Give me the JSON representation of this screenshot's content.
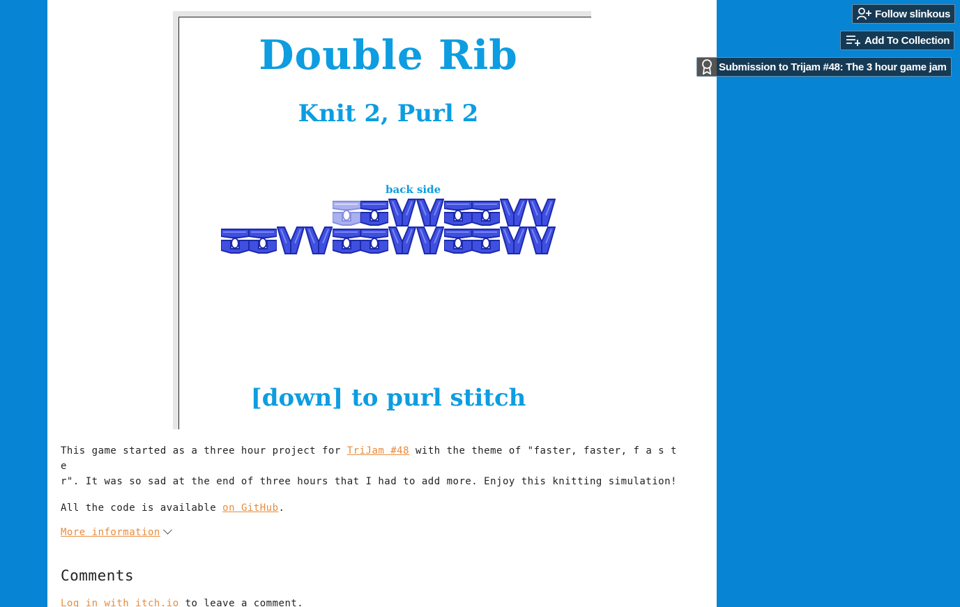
{
  "game": {
    "title": "Double Rib",
    "subtitle": "Knit 2, Purl 2",
    "side_label": "back side",
    "instruction": "[down] to purl stitch",
    "top_row": [
      "pending",
      "purl",
      "knit",
      "knit",
      "purl",
      "purl",
      "knit",
      "knit"
    ],
    "bottom_row": [
      "purl",
      "purl",
      "knit",
      "knit",
      "purl",
      "purl",
      "knit",
      "knit",
      "purl",
      "purl",
      "knit",
      "knit"
    ]
  },
  "description": {
    "p1_before": "This game started as a three hour project for ",
    "p1_link": "TriJam #48",
    "p1_after_line1": " with the theme of \"faster, faster, f a s t e",
    "p1_after_line2": "r\".  It was so sad at the end of three hours that I had to add more. Enjoy this knitting simulation!",
    "p2_before": "All the code is available ",
    "p2_link": "on GitHub",
    "p2_after": "."
  },
  "more_info": "More information",
  "comments": {
    "heading": "Comments",
    "login_link": "Log in with itch.io",
    "login_after": " to leave a comment."
  },
  "buttons": {
    "follow": "Follow slinkous",
    "collection": "Add To Collection",
    "jam": "Submission to Trijam #48: The 3 hour game jam"
  },
  "colors": {
    "background": "#0784d4",
    "title": "#0d9de0",
    "yarn": "#3f4fe0",
    "link": "#e98b3b"
  }
}
